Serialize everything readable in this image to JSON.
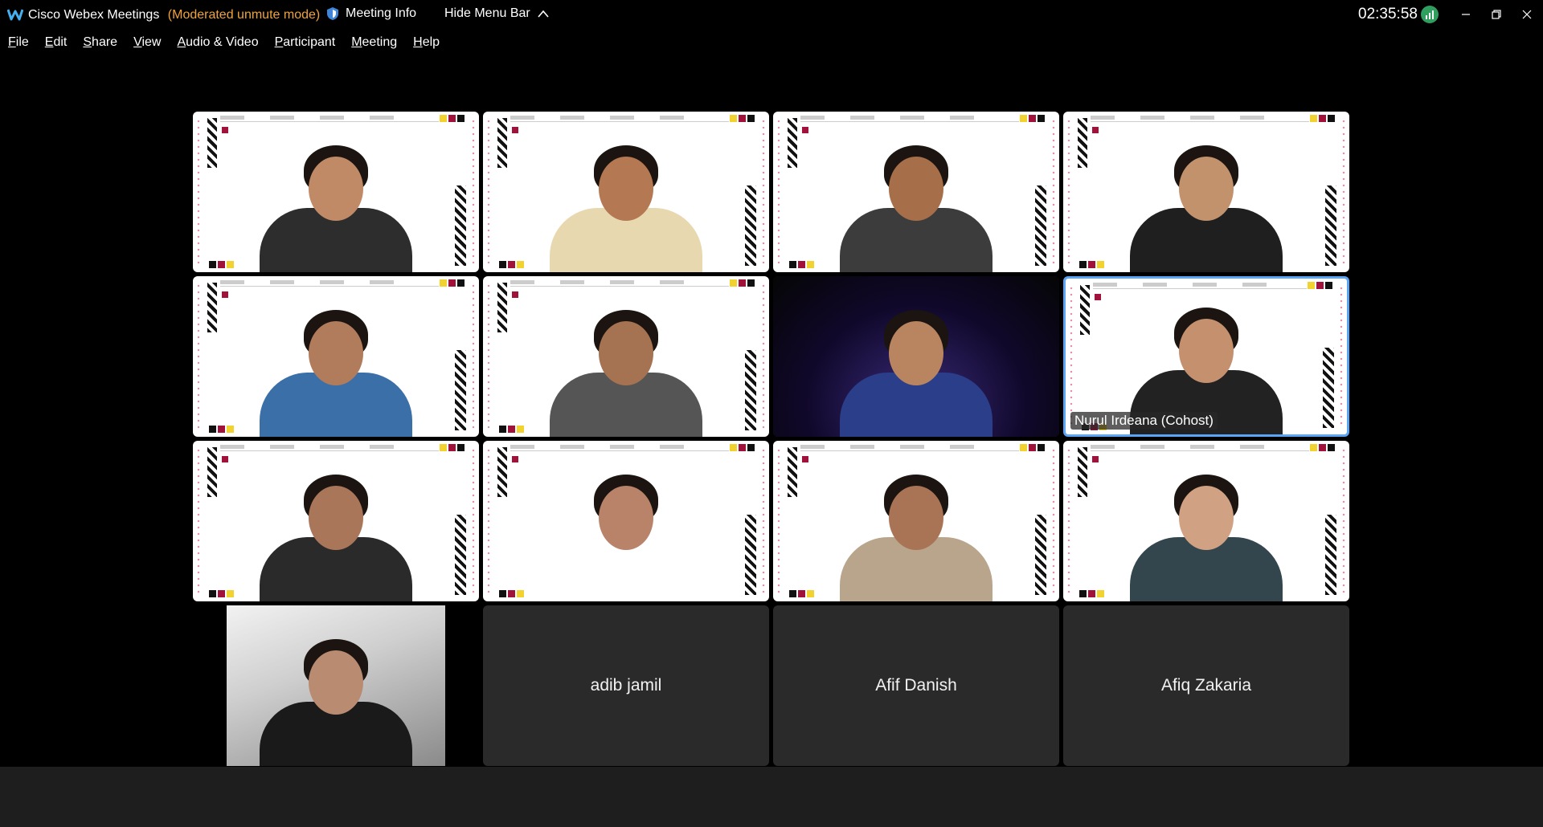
{
  "titlebar": {
    "app_name": "Cisco Webex Meetings",
    "mode": "(Moderated unmute mode)",
    "meeting_info": "Meeting Info",
    "hide_menu": "Hide Menu Bar",
    "clock": "02:35:58",
    "colors": {
      "mode": "#f0a33a",
      "network": "#2f9e5f"
    }
  },
  "menu": [
    {
      "key": "F",
      "rest": "ile"
    },
    {
      "key": "E",
      "rest": "dit"
    },
    {
      "key": "S",
      "rest": "hare"
    },
    {
      "key": "V",
      "rest": "iew"
    },
    {
      "key": "A",
      "rest": "udio & Video"
    },
    {
      "key": "P",
      "rest": "articipant"
    },
    {
      "key": "M",
      "rest": "eeting"
    },
    {
      "key": "H",
      "rest": "elp"
    }
  ],
  "participants": [
    {
      "kind": "video-slide"
    },
    {
      "kind": "video-slide"
    },
    {
      "kind": "video-slide"
    },
    {
      "kind": "video-slide"
    },
    {
      "kind": "video-slide"
    },
    {
      "kind": "video-slide"
    },
    {
      "kind": "video-dark"
    },
    {
      "kind": "video-slide",
      "name": "Nurul Irdeana (Cohost)",
      "active": true
    },
    {
      "kind": "video-slide"
    },
    {
      "kind": "video-slide"
    },
    {
      "kind": "video-slide"
    },
    {
      "kind": "video-slide"
    },
    {
      "kind": "video-photo"
    },
    {
      "kind": "no-video",
      "name": "adib jamil"
    },
    {
      "kind": "no-video",
      "name": "Afif Danish"
    },
    {
      "kind": "no-video",
      "name": "Afiq Zakaria"
    }
  ],
  "active_speaker_color": "#5aa5f5"
}
